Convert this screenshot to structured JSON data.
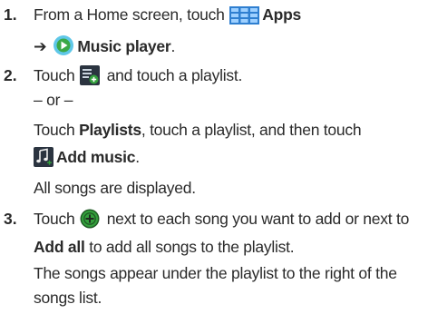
{
  "steps": [
    {
      "number": "1.",
      "line1_pre": "From a Home screen, touch ",
      "apps_label": "Apps",
      "arrow": "➔",
      "music_player_label": "Music player",
      "period": "."
    },
    {
      "number": "2.",
      "touch_word": "Touch",
      "after_icon": " and touch a playlist.",
      "or_text": "– or –",
      "alt_pre": "Touch ",
      "playlists_label": "Playlists",
      "alt_post": ", touch a playlist, and then touch",
      "add_music_label": "Add music",
      "period": ".",
      "result": "All songs are displayed."
    },
    {
      "number": "3.",
      "touch_word": "Touch",
      "line1_post": " next to each song you want to add or next to",
      "add_all_label": "Add all",
      "line2_post": " to add all songs to the playlist.",
      "result_line1": "The songs appear under the playlist to the right of the",
      "result_line2": "songs list."
    }
  ],
  "icons": {
    "apps": "apps-grid-icon",
    "music_player": "music-player-icon",
    "add_to_playlist": "add-to-playlist-icon",
    "add_music": "add-music-icon",
    "add": "add-circle-icon"
  },
  "colors": {
    "text": "#2a2a2a",
    "apps_blue": "#2f7fd0",
    "music_green": "#3aa847",
    "icon_dark": "#2b3440",
    "add_green": "#33a03c"
  }
}
